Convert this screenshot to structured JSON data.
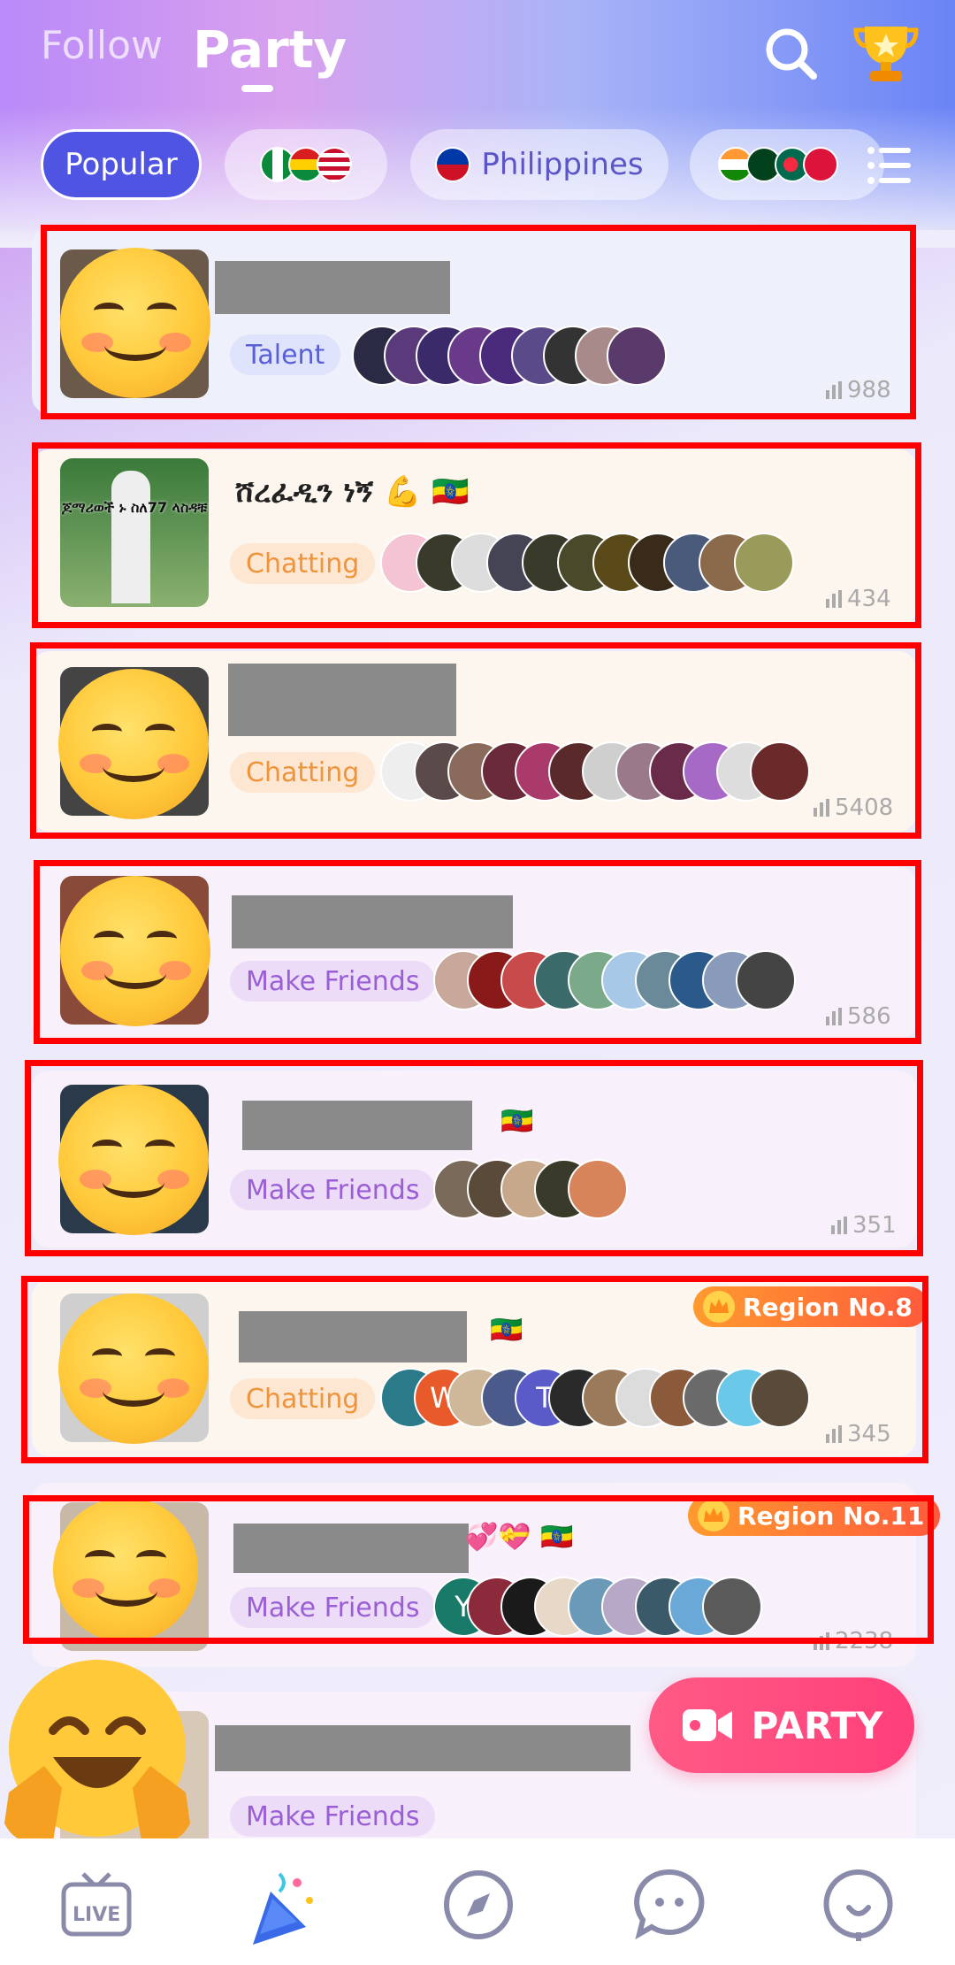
{
  "header": {
    "tab_follow": "Follow",
    "tab_party": "Party",
    "search_icon": "search-icon",
    "trophy_icon": "trophy-icon"
  },
  "filters": {
    "popular": "Popular",
    "philippines": "Philippines",
    "flag_group_1": [
      "nigeria",
      "ghana",
      "usa"
    ],
    "flag_group_2": [
      "india",
      "pakistan",
      "bangladesh",
      "nepal"
    ]
  },
  "rooms": [
    {
      "title": "",
      "tag": "Talent",
      "count": "988"
    },
    {
      "title": "ሸረፈዲን ነኝ 💪 🇪🇹",
      "tag": "Chatting",
      "count": "434",
      "thumb_text": "ጆማሪወች ኑ ስለ77 ላስዳቹ"
    },
    {
      "title": "",
      "tag": "Chatting",
      "count": "5408"
    },
    {
      "title": "",
      "tag": "Make Friends",
      "count": "586"
    },
    {
      "title": "🇪🇹",
      "tag": "Make Friends",
      "count": "351"
    },
    {
      "title": "🇪🇹",
      "tag": "Chatting",
      "count": "345",
      "region": "Region No.8"
    },
    {
      "title": "💞💝 🇪🇹",
      "tag": "Make Friends",
      "count": "2238",
      "region": "Region No.11",
      "avatar_letter": "Y"
    },
    {
      "title": "",
      "tag": "Make Friends",
      "count": ""
    }
  ],
  "letters": {
    "w": "W",
    "t": "T"
  },
  "party_button": "PARTY",
  "nav": [
    "live-icon",
    "party-icon",
    "explore-icon",
    "chat-icon",
    "profile-icon"
  ],
  "nav_live_label": "LIVE",
  "colors": {
    "accent": "#4f55e2",
    "party": "#ff4a80",
    "redbox": "#ff0000"
  }
}
